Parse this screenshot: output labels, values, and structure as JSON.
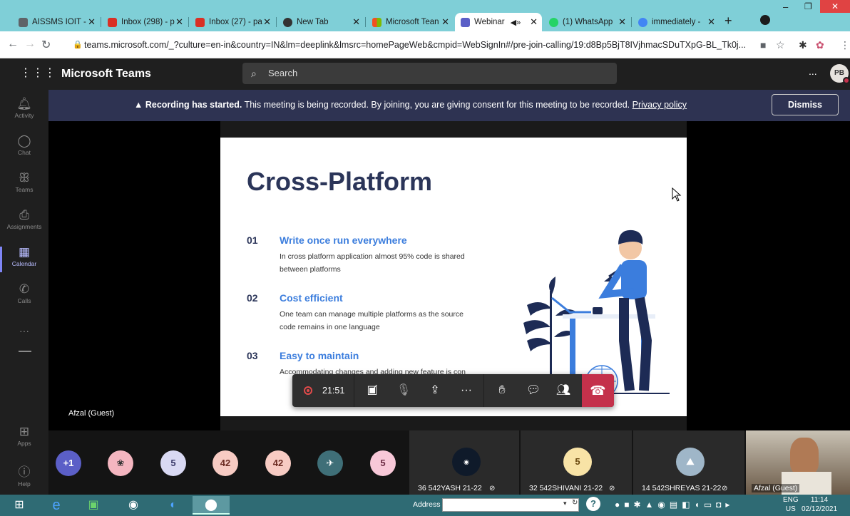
{
  "browser": {
    "tabs": [
      {
        "label": "AISSMS IOIT -",
        "icon_color": "#5f6368"
      },
      {
        "label": "Inbox (298) - p",
        "icon_color": "#d93025"
      },
      {
        "label": "Inbox (27) - pa",
        "icon_color": "#d93025"
      },
      {
        "label": "New Tab",
        "icon_color": "#333333"
      },
      {
        "label": "Microsoft Tean",
        "icon_color": "#e6722c"
      },
      {
        "label": "Webinar",
        "icon_color": "#5b5fc7",
        "active": true
      },
      {
        "label": "(1) WhatsApp",
        "icon_color": "#25d366"
      },
      {
        "label": "immediately -",
        "icon_color": "#4285f4"
      }
    ],
    "url": "teams.microsoft.com/_?culture=en-in&country=IN&lm=deeplink&lmsrc=homePageWeb&cmpid=WebSignIn#/pre-join-calling/19:d8Bp5BjT8IVjhmacSDuTXpG-BL_Tk0j..."
  },
  "teams": {
    "app_name": "Microsoft Teams",
    "search_placeholder": "Search",
    "avatar_initials": "PB",
    "more": "...",
    "rail": [
      {
        "label": "Activity",
        "icon": "bell-icon"
      },
      {
        "label": "Chat",
        "icon": "chat-icon"
      },
      {
        "label": "Teams",
        "icon": "teams-icon"
      },
      {
        "label": "Assignments",
        "icon": "assignments-icon"
      },
      {
        "label": "Calendar",
        "icon": "calendar-icon",
        "active": true
      },
      {
        "label": "Calls",
        "icon": "phone-icon"
      },
      {
        "label": "Apps",
        "icon": "apps-icon"
      },
      {
        "label": "Help",
        "icon": "help-icon"
      }
    ]
  },
  "banner": {
    "bold": "Recording has started.",
    "text": "This meeting is being recorded. By joining, you are giving consent for this meeting to be recorded.",
    "link": "Privacy policy",
    "dismiss": "Dismiss"
  },
  "slide": {
    "title": "Cross-Platform",
    "points": [
      {
        "num": "01",
        "head": "Write once run everywhere",
        "body": "In cross platform application almost 95% code is shared between platforms"
      },
      {
        "num": "02",
        "head": "Cost efficient",
        "body": "One team can manage multiple platforms as the source code remains in one language"
      },
      {
        "num": "03",
        "head": "Easy to maintain",
        "body": "Accommodating changes and adding new feature is con"
      }
    ]
  },
  "presenter_label": "Afzal (Guest)",
  "call": {
    "timer": "21:51"
  },
  "participants": {
    "bubbles": [
      {
        "text": "+1",
        "bg": "#5b5fc7",
        "fg": "#ffffff"
      },
      {
        "text": "",
        "bg": "#f4b6c0",
        "fg": "#333333"
      },
      {
        "text": "5",
        "bg": "#d9d9f3",
        "fg": "#3b3b6b"
      },
      {
        "text": "42",
        "bg": "#f7cbc3",
        "fg": "#6b2b22"
      },
      {
        "text": "42",
        "bg": "#f7cbc3",
        "fg": "#6b2b22"
      },
      {
        "text": "",
        "bg": "#3f6f78",
        "fg": "#ffffff"
      },
      {
        "text": "5",
        "bg": "#f8c8d8",
        "fg": "#6b2b44"
      }
    ],
    "tiles": [
      {
        "name": "36 542YASH 21-22",
        "avatar": "",
        "bg": "#0f1a2a"
      },
      {
        "name": "32 542SHIVANI 21-22",
        "avatar": "5",
        "bg": "#f8e3a6"
      },
      {
        "name": "14 542SHREYAS 21-22",
        "avatar": "",
        "bg": "#9fb6c8"
      },
      {
        "name": "Afzal (Guest)",
        "avatar": "",
        "bg": "#6b5a48"
      }
    ]
  },
  "taskbar": {
    "address_label": "Address",
    "lang_top": "ENG",
    "lang_bottom": "US",
    "time": "11:14",
    "date": "02/12/2021"
  }
}
